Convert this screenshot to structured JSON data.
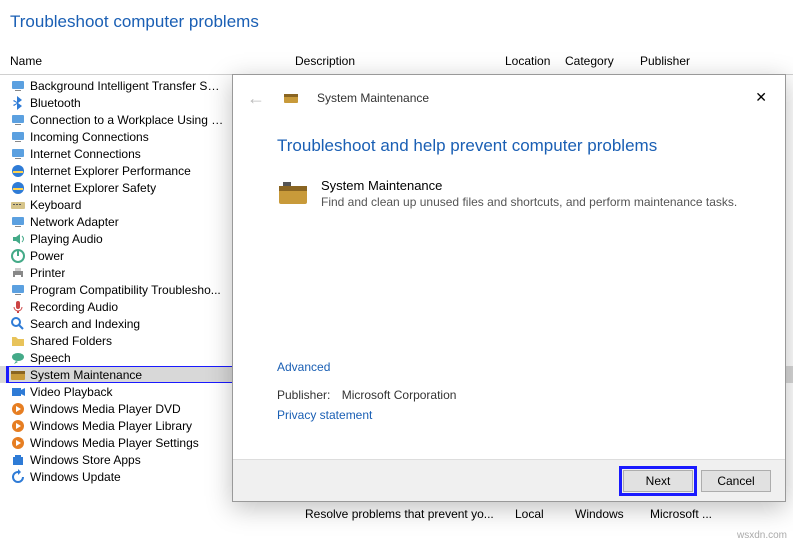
{
  "page_title": "Troubleshoot computer problems",
  "columns": {
    "name": "Name",
    "description": "Description",
    "location": "Location",
    "category": "Category",
    "publisher": "Publisher"
  },
  "items": [
    {
      "label": "Background Intelligent Transfer Ser...",
      "icon": "download-cloud"
    },
    {
      "label": "Bluetooth",
      "icon": "bluetooth"
    },
    {
      "label": "Connection to a Workplace Using D...",
      "icon": "network"
    },
    {
      "label": "Incoming Connections",
      "icon": "incoming"
    },
    {
      "label": "Internet Connections",
      "icon": "internet"
    },
    {
      "label": "Internet Explorer Performance",
      "icon": "ie"
    },
    {
      "label": "Internet Explorer Safety",
      "icon": "ie"
    },
    {
      "label": "Keyboard",
      "icon": "keyboard"
    },
    {
      "label": "Network Adapter",
      "icon": "network-adapter"
    },
    {
      "label": "Playing Audio",
      "icon": "speaker"
    },
    {
      "label": "Power",
      "icon": "power"
    },
    {
      "label": "Printer",
      "icon": "printer"
    },
    {
      "label": "Program Compatibility Troublesho...",
      "icon": "compat"
    },
    {
      "label": "Recording Audio",
      "icon": "mic"
    },
    {
      "label": "Search and Indexing",
      "icon": "search"
    },
    {
      "label": "Shared Folders",
      "icon": "folder"
    },
    {
      "label": "Speech",
      "icon": "speech"
    },
    {
      "label": "System Maintenance",
      "icon": "maintenance",
      "selected": true
    },
    {
      "label": "Video Playback",
      "icon": "video"
    },
    {
      "label": "Windows Media Player DVD",
      "icon": "wmp"
    },
    {
      "label": "Windows Media Player Library",
      "icon": "wmp"
    },
    {
      "label": "Windows Media Player Settings",
      "icon": "wmp"
    },
    {
      "label": "Windows Store Apps",
      "icon": "store"
    },
    {
      "label": "Windows Update",
      "icon": "update"
    }
  ],
  "bg_row": {
    "description": "Resolve problems that prevent yo...",
    "location": "Local",
    "category": "Windows",
    "publisher": "Microsoft ..."
  },
  "dialog": {
    "header_title": "System Maintenance",
    "heading": "Troubleshoot and help prevent computer problems",
    "item_title": "System Maintenance",
    "item_desc": "Find and clean up unused files and shortcuts, and perform maintenance tasks.",
    "advanced": "Advanced",
    "publisher_label": "Publisher:",
    "publisher_value": "Microsoft Corporation",
    "privacy": "Privacy statement",
    "next": "Next",
    "cancel": "Cancel"
  },
  "watermark": "wsxdn.com"
}
